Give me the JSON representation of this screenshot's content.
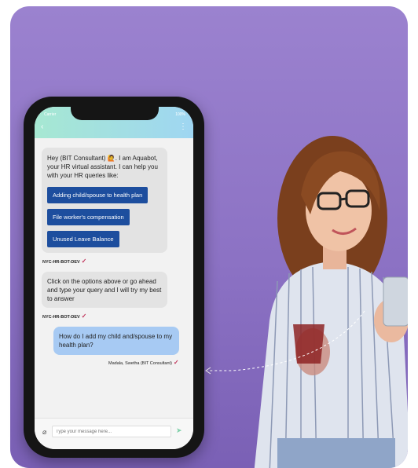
{
  "status": {
    "carrier": "Carrier",
    "battery": "100%"
  },
  "nav": {
    "back_icon": "chevron-left-icon",
    "menu_icon": "kebab-menu-icon"
  },
  "chat": {
    "greeting": "Hey (BIT Consultant) 🙋. I am Aquabot, your HR virtual assistant. I can help you with your HR queries like:",
    "options": [
      "Adding child/spouse to health plan",
      "File worker's compensation",
      "Unused Leave Balance"
    ],
    "bot_sender": "NYC-HR-BOT-DEV",
    "followup": "Click on the options above or go ahead and type your query and I will try my best to answer",
    "user_message": "How do I add my child and/spouse to my health plan?",
    "user_sender": "Madala, Swetha (BIT Consultant)",
    "check_mark": "✓"
  },
  "composer": {
    "placeholder": "Type your message here...",
    "attach_icon": "paperclip-icon",
    "send_icon": "send-icon"
  },
  "colors": {
    "background": "#9b82cf",
    "option_button": "#1d4e9e",
    "user_bubble": "#a7caf3",
    "header": "#a6e8d2"
  }
}
